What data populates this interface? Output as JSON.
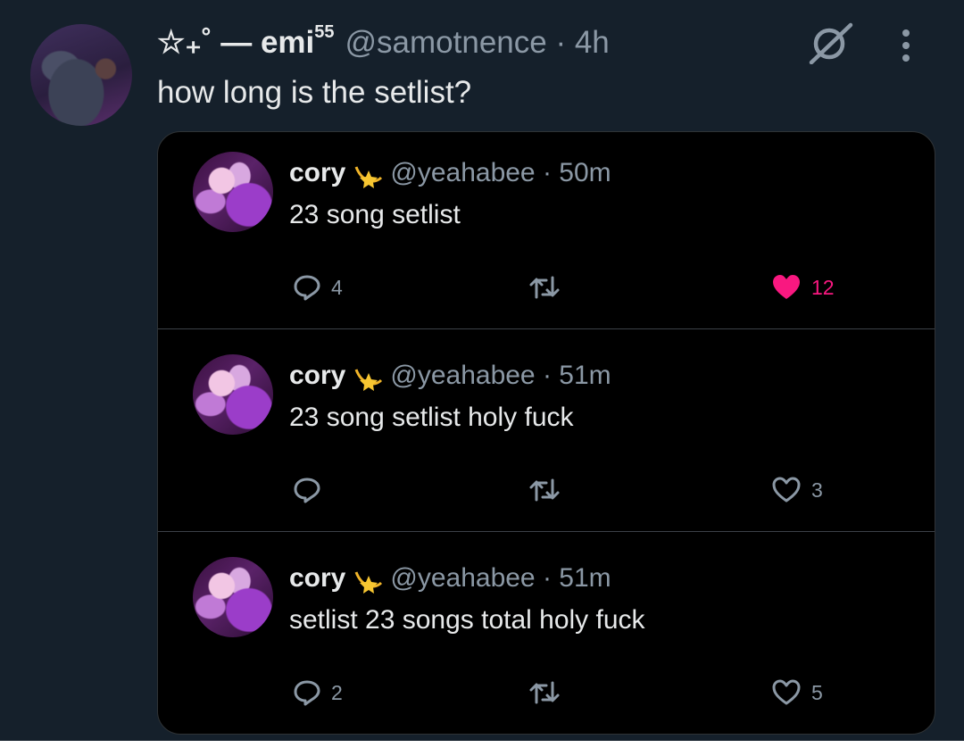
{
  "post": {
    "author": {
      "display_name": "☆₊˚ — emi",
      "display_name_sup": "55",
      "handle": "@samotnence",
      "separator": " · ",
      "time": "4h"
    },
    "text": "how long is the setlist?",
    "icons": {
      "grok": "grok-icon",
      "more": "more-icon"
    }
  },
  "replies": [
    {
      "name": "cory",
      "emoji": "shooting-star-emoji",
      "handle": "@yeahabee",
      "time": "50m",
      "text": "23 song setlist",
      "replies_count": "4",
      "likes_count": "12",
      "liked": true
    },
    {
      "name": "cory",
      "emoji": "shooting-star-emoji",
      "handle": "@yeahabee",
      "time": "51m",
      "text": "23 song setlist holy fuck",
      "replies_count": "",
      "likes_count": "3",
      "liked": false
    },
    {
      "name": "cory",
      "emoji": "shooting-star-emoji",
      "handle": "@yeahabee",
      "time": "51m",
      "text": "setlist 23 songs total holy fuck",
      "replies_count": "2",
      "likes_count": "5",
      "liked": false
    }
  ],
  "colors": {
    "background": "#15202b",
    "card": "#000000",
    "text": "#e7e9ea",
    "muted": "#8b98a5",
    "like": "#f91880"
  }
}
